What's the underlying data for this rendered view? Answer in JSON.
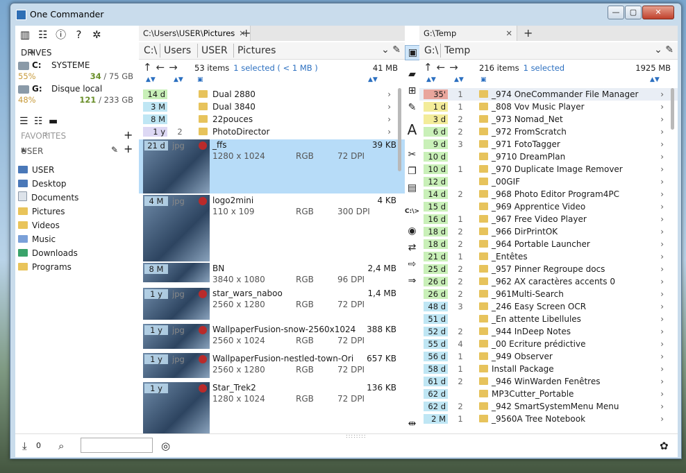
{
  "window": {
    "title": "One Commander",
    "min": "—",
    "max": "▢",
    "close": "✕"
  },
  "sidebar": {
    "toolbar_icons": [
      "columns-icon",
      "sliders-icon",
      "info-icon",
      "help-icon",
      "atom-icon"
    ],
    "drives_header": "DRIVES",
    "drives": [
      {
        "letter": "C:",
        "label": "SYSTEME",
        "percent": "55%",
        "free": "34",
        "total": "/ 75 GB"
      },
      {
        "letter": "G:",
        "label": "Disque local",
        "percent": "48%",
        "free": "121",
        "total": "/ 233 GB"
      }
    ],
    "favorites_header": "FAVORITES",
    "user_header": "USER",
    "items": [
      "USER",
      "Desktop",
      "Documents",
      "Pictures",
      "Videos",
      "Music",
      "Downloads",
      "Programs"
    ]
  },
  "left": {
    "tab_prefix": "C:\\Users\\USER\\",
    "tab_last": "Pictures",
    "tab_close": "✕",
    "tab_add": "+",
    "crumbs": [
      "C:\\",
      "Users",
      "USER",
      "Pictures"
    ],
    "count": "53 items",
    "selected": "1 selected ( < 1 MB )",
    "total": "41 MB",
    "folders": [
      {
        "age": "14 d",
        "age_color": "#c9f0b8",
        "count": "",
        "name": "Dual 2880"
      },
      {
        "age": "3 M",
        "age_color": "#bfe6f4",
        "count": "",
        "name": "Dual 3840"
      },
      {
        "age": "8 M",
        "age_color": "#bfe6f4",
        "count": "",
        "name": "22pouces"
      },
      {
        "age": "1 y",
        "age_color": "#ddd8f4",
        "count": "2",
        "name": "PhotoDirector"
      }
    ],
    "images": [
      {
        "age": "21 d",
        "ext": "jpg",
        "name": "_ffs",
        "size": "39 KB",
        "dims": "1280 x 1024",
        "mode": "RGB",
        "dpi": "72 DPI"
      },
      {
        "age": "4 M",
        "ext": "jpg",
        "name": "logo2mini",
        "size": "4 KB",
        "dims": "110 x 109",
        "mode": "RGB",
        "dpi": "300 DPI"
      },
      {
        "age": "8 M",
        "ext": "",
        "name": "BN",
        "size": "2,4 MB",
        "dims": "3840 x 1080",
        "mode": "RGB",
        "dpi": "96 DPI"
      },
      {
        "age": "1 y",
        "ext": "jpg",
        "name": "star_wars_naboo",
        "size": "1,4 MB",
        "dims": "2560 x 1280",
        "mode": "RGB",
        "dpi": "72 DPI"
      },
      {
        "age": "1 y",
        "ext": "jpg",
        "name": "WallpaperFusion-snow-2560x1024",
        "size": "388 KB",
        "dims": "2560 x 1024",
        "mode": "RGB",
        "dpi": "72 DPI"
      },
      {
        "age": "1 y",
        "ext": "jpg",
        "name": "WallpaperFusion-nestled-town-Ori",
        "size": "657 KB",
        "dims": "2560 x 1280",
        "mode": "RGB",
        "dpi": "72 DPI"
      },
      {
        "age": "1 y",
        "ext": "",
        "name": "Star_Trek2",
        "size": "136 KB",
        "dims": "1280 x 1024",
        "mode": "RGB",
        "dpi": "72 DPI"
      }
    ]
  },
  "right": {
    "tab_label": "G:\\Temp",
    "tab_close": "✕",
    "tab_add": "+",
    "crumbs": [
      "G:\\",
      "Temp"
    ],
    "count": "216 items",
    "selected": "1 selected",
    "total": "1925 MB",
    "rows": [
      {
        "age": "35'",
        "age_color": "#e9a59c",
        "count": "1",
        "name": "_974 OneCommander File Manager"
      },
      {
        "age": "1 d",
        "age_color": "#f3ec9a",
        "count": "1",
        "name": "_808 Vov Music Player"
      },
      {
        "age": "3 d",
        "age_color": "#f3ec9a",
        "count": "2",
        "name": "_973 Nomad_Net"
      },
      {
        "age": "6 d",
        "age_color": "#c9f0b8",
        "count": "2",
        "name": "_972 FromScratch"
      },
      {
        "age": "9 d",
        "age_color": "#c9f0b8",
        "count": "3",
        "name": "_971 FotoTagger"
      },
      {
        "age": "10 d",
        "age_color": "#c9f0b8",
        "count": "",
        "name": "_9710 DreamPlan"
      },
      {
        "age": "10 d",
        "age_color": "#c9f0b8",
        "count": "1",
        "name": "_970 Duplicate Image Remover"
      },
      {
        "age": "12 d",
        "age_color": "#c9f0b8",
        "count": "",
        "name": "_00GIF"
      },
      {
        "age": "14 d",
        "age_color": "#c9f0b8",
        "count": "2",
        "name": "_968 Photo Editor Program4PC"
      },
      {
        "age": "15 d",
        "age_color": "#c9f0b8",
        "count": "",
        "name": "_969 Apprentice Video"
      },
      {
        "age": "16 d",
        "age_color": "#c9f0b8",
        "count": "1",
        "name": "_967 Free Video Player"
      },
      {
        "age": "18 d",
        "age_color": "#c9f0b8",
        "count": "2",
        "name": "_966 DirPrintOK"
      },
      {
        "age": "18 d",
        "age_color": "#c9f0b8",
        "count": "2",
        "name": "_964 Portable Launcher"
      },
      {
        "age": "21 d",
        "age_color": "#c9f0b8",
        "count": "1",
        "name": "_Entêtes"
      },
      {
        "age": "25 d",
        "age_color": "#c9f0b8",
        "count": "2",
        "name": "_957 Pinner Regroupe docs"
      },
      {
        "age": "26 d",
        "age_color": "#c9f0b8",
        "count": "2",
        "name": "_962 AX caractères accents 0"
      },
      {
        "age": "26 d",
        "age_color": "#c9f0b8",
        "count": "2",
        "name": "_961Multi-Search"
      },
      {
        "age": "48 d",
        "age_color": "#bfe6f4",
        "count": "3",
        "name": "_246 Easy Screen OCR"
      },
      {
        "age": "51 d",
        "age_color": "#bfe6f4",
        "count": "",
        "name": "_En attente Libellules"
      },
      {
        "age": "52 d",
        "age_color": "#bfe6f4",
        "count": "2",
        "name": "_944 InDeep Notes"
      },
      {
        "age": "55 d",
        "age_color": "#bfe6f4",
        "count": "4",
        "name": "_00 Ecriture prédictive"
      },
      {
        "age": "56 d",
        "age_color": "#bfe6f4",
        "count": "1",
        "name": "_949  Observer"
      },
      {
        "age": "58 d",
        "age_color": "#bfe6f4",
        "count": "1",
        "name": "Install Package"
      },
      {
        "age": "61 d",
        "age_color": "#bfe6f4",
        "count": "2",
        "name": "_946 WinWarden Fenêtres"
      },
      {
        "age": "62 d",
        "age_color": "#bfe6f4",
        "count": "",
        "name": "MP3Cutter_Portable"
      },
      {
        "age": "62 d",
        "age_color": "#bfe6f4",
        "count": "2",
        "name": "_942 SmartSystemMenu Menu"
      },
      {
        "age": "2 M",
        "age_color": "#bfe6f4",
        "count": "1",
        "name": "_9560A Tree Notebook"
      }
    ]
  },
  "midbar": {
    "items": [
      "image-view-icon",
      "new-folder-icon",
      "new-file-icon",
      "edit-icon",
      "rename-icon",
      "cut-icon",
      "copy-icon",
      "paste-icon",
      "path-icon",
      "view-icon",
      "swap-icon",
      "move-icon",
      "arrow-right-icon",
      "split-icon"
    ],
    "path_label": "C:\\>",
    "rename_label": "A"
  },
  "bottom": {
    "queue_count": "0",
    "search_placeholder": ""
  }
}
